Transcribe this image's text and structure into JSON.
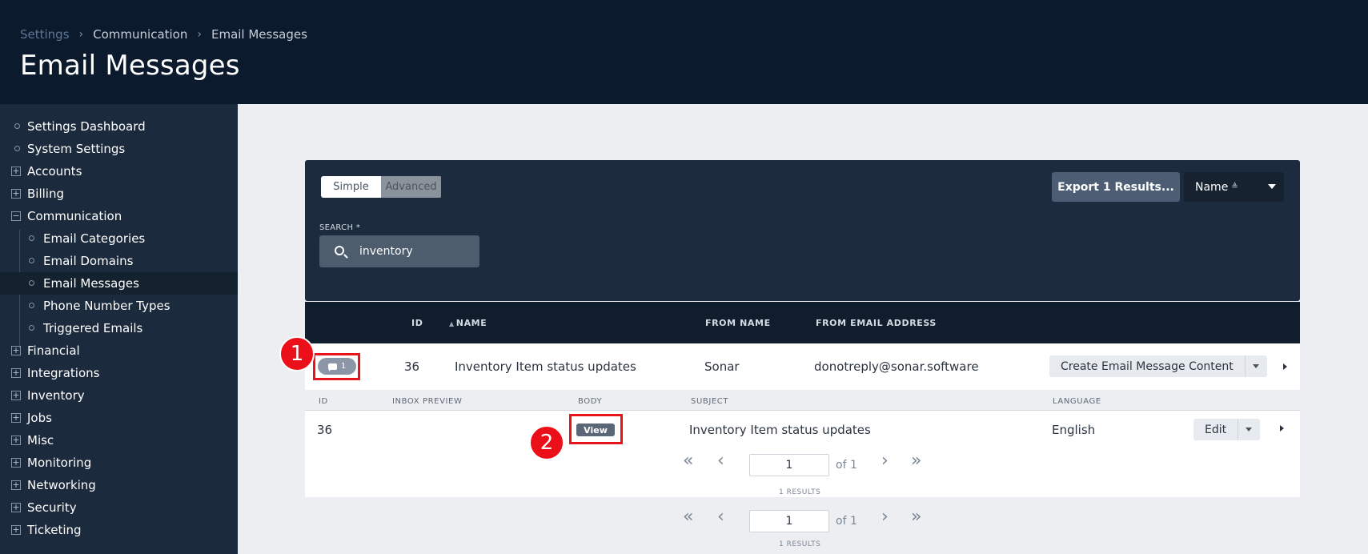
{
  "breadcrumb": {
    "items": [
      "Settings",
      "Communication",
      "Email Messages"
    ]
  },
  "page_title": "Email Messages",
  "sidebar": {
    "items": [
      {
        "label": "Settings Dashboard",
        "icon": "circle-icon"
      },
      {
        "label": "System Settings",
        "icon": "circle-icon"
      },
      {
        "label": "Accounts",
        "icon": "expand-icon",
        "symbol": "+"
      },
      {
        "label": "Billing",
        "icon": "expand-icon",
        "symbol": "+"
      },
      {
        "label": "Communication",
        "icon": "collapse-icon",
        "symbol": "−"
      },
      {
        "label": "Email Categories",
        "icon": "circle-icon"
      },
      {
        "label": "Email Domains",
        "icon": "circle-icon"
      },
      {
        "label": "Email Messages",
        "icon": "circle-icon",
        "active": true
      },
      {
        "label": "Phone Number Types",
        "icon": "circle-icon"
      },
      {
        "label": "Triggered Emails",
        "icon": "circle-icon"
      },
      {
        "label": "Financial",
        "icon": "expand-icon",
        "symbol": "+"
      },
      {
        "label": "Integrations",
        "icon": "expand-icon",
        "symbol": "+"
      },
      {
        "label": "Inventory",
        "icon": "expand-icon",
        "symbol": "+"
      },
      {
        "label": "Jobs",
        "icon": "expand-icon",
        "symbol": "+"
      },
      {
        "label": "Misc",
        "icon": "expand-icon",
        "symbol": "+"
      },
      {
        "label": "Monitoring",
        "icon": "expand-icon",
        "symbol": "+"
      },
      {
        "label": "Networking",
        "icon": "expand-icon",
        "symbol": "+"
      },
      {
        "label": "Security",
        "icon": "expand-icon",
        "symbol": "+"
      },
      {
        "label": "Ticketing",
        "icon": "expand-icon",
        "symbol": "+"
      }
    ]
  },
  "search": {
    "mode_simple": "Simple",
    "mode_advanced": "Advanced",
    "label": "SEARCH",
    "label_mark": "*",
    "value": "inventory",
    "export_label": "Export 1 Results...",
    "sort_label": "Name",
    "sort_icon": "≜"
  },
  "table": {
    "headers": {
      "id": "ID",
      "name": "NAME",
      "from_name": "FROM NAME",
      "from_email": "FROM EMAIL ADDRESS"
    },
    "sort_arrow": "▲",
    "row": {
      "badge_count": "1",
      "id": "36",
      "name": "Inventory Item status updates",
      "from_name": "Sonar",
      "from_email": "donotreply@sonar.software",
      "action_label": "Create Email Message Content"
    }
  },
  "sub_table": {
    "headers": {
      "id": "ID",
      "inbox_preview": "INBOX PREVIEW",
      "body": "BODY",
      "subject": "SUBJECT",
      "language": "LANGUAGE"
    },
    "row": {
      "id": "36",
      "body_button": "View",
      "subject": "Inventory Item status updates",
      "language": "English",
      "action_label": "Edit"
    },
    "pager": {
      "page": "1",
      "of_label": "of 1",
      "results": "1 RESULTS"
    }
  },
  "outer_pager": {
    "page": "1",
    "of_label": "of 1",
    "results": "1 RESULTS"
  },
  "annotations": {
    "marker_1": "1",
    "marker_2": "2"
  },
  "colors": {
    "accent": "#e8141c",
    "header_bg": "#0b1a2c",
    "sidebar_bg": "#1b2a3c"
  }
}
